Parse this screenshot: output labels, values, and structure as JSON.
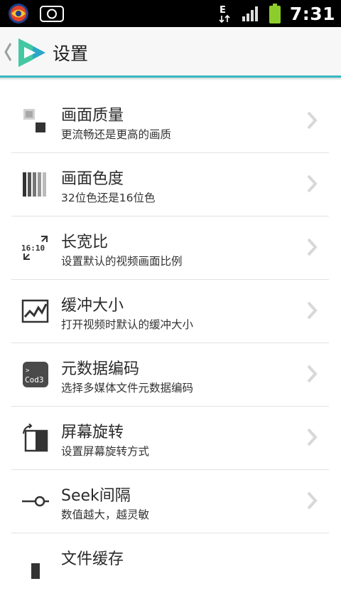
{
  "status_bar": {
    "time": "7:31",
    "network_label": "E"
  },
  "header": {
    "title": "设置"
  },
  "settings": [
    {
      "icon": "image-quality-icon",
      "label": "画面质量",
      "sub": "更流畅还是更高的画质"
    },
    {
      "icon": "color-depth-icon",
      "label": "画面色度",
      "sub": "32位色还是16位色"
    },
    {
      "icon": "aspect-ratio-icon",
      "label": "长宽比",
      "sub": "设置默认的视频画面比例"
    },
    {
      "icon": "buffer-graph-icon",
      "label": "缓冲大小",
      "sub": "打开视频时默认的缓冲大小"
    },
    {
      "icon": "encoding-icon",
      "label": "元数据编码",
      "sub": "选择多媒体文件元数据编码"
    },
    {
      "icon": "screen-rotation-icon",
      "label": "屏幕旋转",
      "sub": "设置屏幕旋转方式"
    },
    {
      "icon": "seek-slider-icon",
      "label": "Seek间隔",
      "sub": "数值越大，越灵敏"
    },
    {
      "icon": "file-cache-icon",
      "label": "文件缓存",
      "sub": ""
    }
  ],
  "icons_text": {
    "aspect_ratio": "16:10",
    "encoding": "Cod3"
  },
  "colors": {
    "accent": "#37b8bf",
    "status_bar_bg": "#000000",
    "title_bar_bg": "#f7f7f7",
    "battery": "#8ccd2b"
  }
}
